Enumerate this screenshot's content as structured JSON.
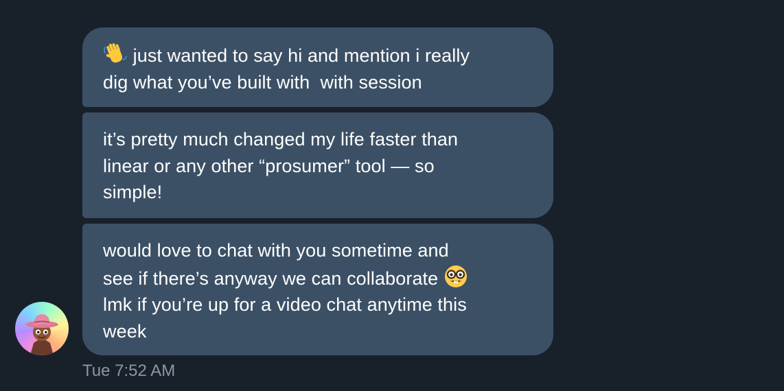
{
  "messages": [
    {
      "lines": [
        "just wanted to say hi and mention i really",
        "dig what you’ve built with  with session"
      ],
      "emoji": "waving-hand-emoji"
    },
    {
      "lines": [
        "it’s pretty much changed my life faster than",
        "linear or any other “prosumer” tool — so",
        "simple!"
      ]
    },
    {
      "lines": [
        "would love to chat with you sometime and",
        "see if there’s anyway we can collaborate",
        "lmk if you’re up for a video chat anytime this",
        "week"
      ],
      "emoji": "nerd-face-emoji"
    }
  ],
  "timestamp": "Tue 7:52 AM",
  "avatar": "cowboy-memoji-avatar",
  "colors": {
    "background": "#18202a",
    "bubble": "#3c5065",
    "text": "#ffffff",
    "timestamp": "#8a97a5"
  }
}
